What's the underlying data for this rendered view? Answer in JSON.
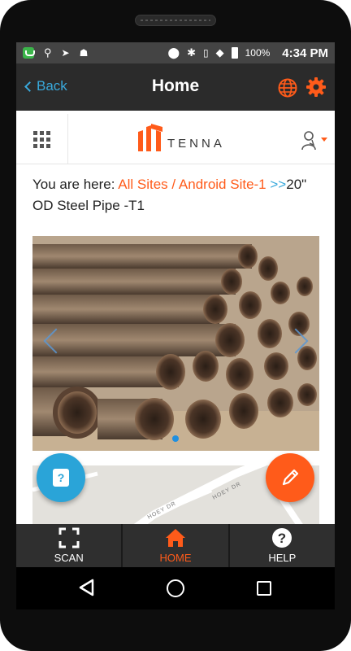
{
  "status_bar": {
    "battery": "100%",
    "time": "4:34 PM"
  },
  "header": {
    "back_label": "Back",
    "title": "Home"
  },
  "logo": {
    "text": "TENNA"
  },
  "breadcrumb": {
    "prefix": "You are here:",
    "link1": "All Sites",
    "sep1": " / ",
    "link2": "Android Site-1",
    "sep2": " >>",
    "current": "20\" OD Steel Pipe -T1"
  },
  "map": {
    "street1": "HOEY DR",
    "street2": "HOEY DR"
  },
  "tabs": [
    {
      "label": "SCAN",
      "icon": "scan-icon"
    },
    {
      "label": "HOME",
      "icon": "home-icon"
    },
    {
      "label": "HELP",
      "icon": "help-icon"
    }
  ],
  "colors": {
    "accent": "#ff5b1a",
    "link_blue": "#39a9dc",
    "header_bg": "#2b2b2b",
    "tab_bg": "#2f2f2f"
  }
}
